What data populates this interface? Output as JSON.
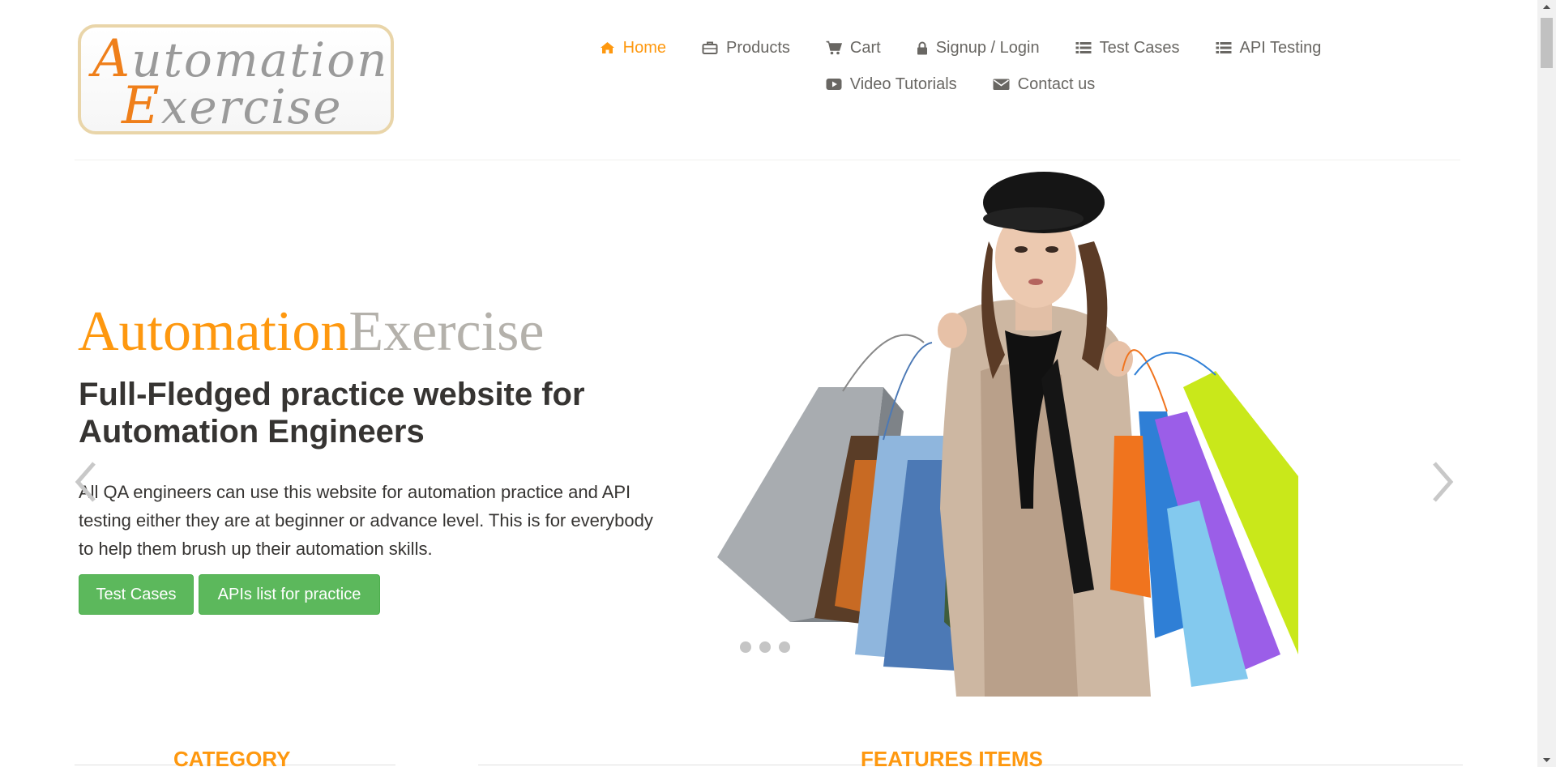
{
  "logo": {
    "line1_cap": "A",
    "line1_rest": "utomation",
    "line2_cap": "E",
    "line2_rest": "xercise"
  },
  "nav": {
    "items": [
      {
        "label": "Home",
        "icon": "home-icon",
        "active": true
      },
      {
        "label": "Products",
        "icon": "briefcase-icon"
      },
      {
        "label": "Cart",
        "icon": "cart-icon"
      },
      {
        "label": "Signup / Login",
        "icon": "lock-icon"
      },
      {
        "label": "Test Cases",
        "icon": "list-icon"
      },
      {
        "label": "API Testing",
        "icon": "list-icon"
      },
      {
        "label": "Video Tutorials",
        "icon": "youtube-play-icon"
      },
      {
        "label": "Contact us",
        "icon": "envelope-icon"
      }
    ]
  },
  "slider": {
    "brand_part1": "Automation",
    "brand_part2": "Exercise",
    "subtitle": "Full-Fledged practice website for Automation Engineers",
    "description": "All QA engineers can use this website for automation practice and API testing either they are at beginner or advance level. This is for everybody to help them brush up their automation skills.",
    "test_cases_button": "Test Cases",
    "apis_button": "APIs list for practice",
    "slide_count": 3,
    "active_slide": 1
  },
  "sections": {
    "category_title": "CATEGORY",
    "features_title": "FEATURES ITEMS"
  },
  "colors": {
    "accent": "#fe980f",
    "nav_text": "#696763",
    "button_green": "#5cb85c",
    "heading_dark": "#363432",
    "brand_grey": "#b4b1ab"
  }
}
